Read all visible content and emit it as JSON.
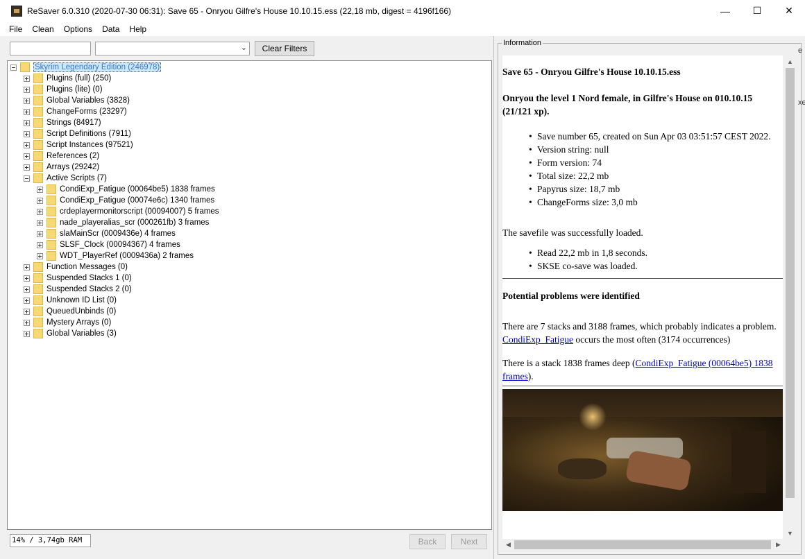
{
  "window": {
    "title": "ReSaver 6.0.310 (2020-07-30 06:31): Save 65 - Onryou  Gilfre's House  10.10.15.ess (22,18 mb, digest = 4196f166)",
    "minimize": "—",
    "maximize": "☐",
    "close": "✕"
  },
  "menu": [
    "File",
    "Clean",
    "Options",
    "Data",
    "Help"
  ],
  "filter": {
    "search_value": "",
    "combo_value": "",
    "clear_label": "Clear Filters"
  },
  "tree": {
    "root": "Skyrim Legendary Edition (246978)",
    "items": [
      {
        "label": "Plugins (full) (250)",
        "level": 1,
        "expanded": false
      },
      {
        "label": "Plugins (lite) (0)",
        "level": 1,
        "expanded": false
      },
      {
        "label": "Global Variables (3828)",
        "level": 1,
        "expanded": false
      },
      {
        "label": "ChangeForms (23297)",
        "level": 1,
        "expanded": false
      },
      {
        "label": "Strings (84917)",
        "level": 1,
        "expanded": false
      },
      {
        "label": "Script Definitions (7911)",
        "level": 1,
        "expanded": false
      },
      {
        "label": "Script Instances (97521)",
        "level": 1,
        "expanded": false
      },
      {
        "label": "References (2)",
        "level": 1,
        "expanded": false
      },
      {
        "label": "Arrays (29242)",
        "level": 1,
        "expanded": false
      },
      {
        "label": "Active Scripts (7)",
        "level": 1,
        "expanded": true
      },
      {
        "label": "CondiExp_Fatigue (00064be5) 1838 frames",
        "level": 2,
        "expanded": false
      },
      {
        "label": "CondiExp_Fatigue (00074e6c) 1340 frames",
        "level": 2,
        "expanded": false
      },
      {
        "label": "crdeplayermonitorscript (00094007) 5 frames",
        "level": 2,
        "expanded": false
      },
      {
        "label": "nade_playeralias_scr (000261fb) 3 frames",
        "level": 2,
        "expanded": false
      },
      {
        "label": "slaMainScr (0009436e) 4 frames",
        "level": 2,
        "expanded": false
      },
      {
        "label": "SLSF_Clock (00094367) 4 frames",
        "level": 2,
        "expanded": false
      },
      {
        "label": "WDT_PlayerRef (0009436a) 2 frames",
        "level": 2,
        "expanded": false
      },
      {
        "label": "Function Messages (0)",
        "level": 1,
        "expanded": false
      },
      {
        "label": "Suspended Stacks 1 (0)",
        "level": 1,
        "expanded": false
      },
      {
        "label": "Suspended Stacks 2 (0)",
        "level": 1,
        "expanded": false
      },
      {
        "label": "Unknown ID List (0)",
        "level": 1,
        "expanded": false
      },
      {
        "label": "QueuedUnbinds (0)",
        "level": 1,
        "expanded": false
      },
      {
        "label": "Mystery Arrays (0)",
        "level": 1,
        "expanded": false
      },
      {
        "label": "Global Variables (3)",
        "level": 1,
        "expanded": false
      }
    ]
  },
  "status": {
    "memory": "14% / 3,74gb RAM",
    "back_label": "Back",
    "next_label": "Next"
  },
  "info": {
    "legend": "Information",
    "heading": "Save 65 - Onryou Gilfre's House 10.10.15.ess",
    "summary": "Onryou the level 1 Nord female, in Gilfre's House on 010.10.15 (21/121 xp).",
    "details": [
      "Save number 65, created on Sun Apr 03 03:51:57 CEST 2022.",
      "Version string: null",
      "Form version: 74",
      "Total size: 22,2 mb",
      "Papyrus size: 18,7 mb",
      "ChangeForms size: 3,0 mb"
    ],
    "loaded_text": "The savefile was successfully loaded.",
    "load_details": [
      "Read 22,2 mb in 1,8 seconds.",
      "SKSE co-save was loaded."
    ],
    "problems_heading": "Potential problems were identified",
    "stacks_text": "There are 7 stacks and 3188 frames, which probably indicates a problem.",
    "often_link": "CondiExp_Fatigue",
    "often_text": " occurs the most often (3174 occurrences)",
    "deep_prefix": "There is a stack 1838 frames deep (",
    "deep_link": "CondiExp_Fatigue (00064be5) 1838 frames",
    "deep_suffix": ")."
  },
  "edge_fragments": [
    "e",
    "xe"
  ],
  "icons": {
    "app": "resaver-app-icon",
    "folder": "folder-icon",
    "expander": "tree-expander-icon",
    "combo_arrow": "chevron-down-icon"
  }
}
